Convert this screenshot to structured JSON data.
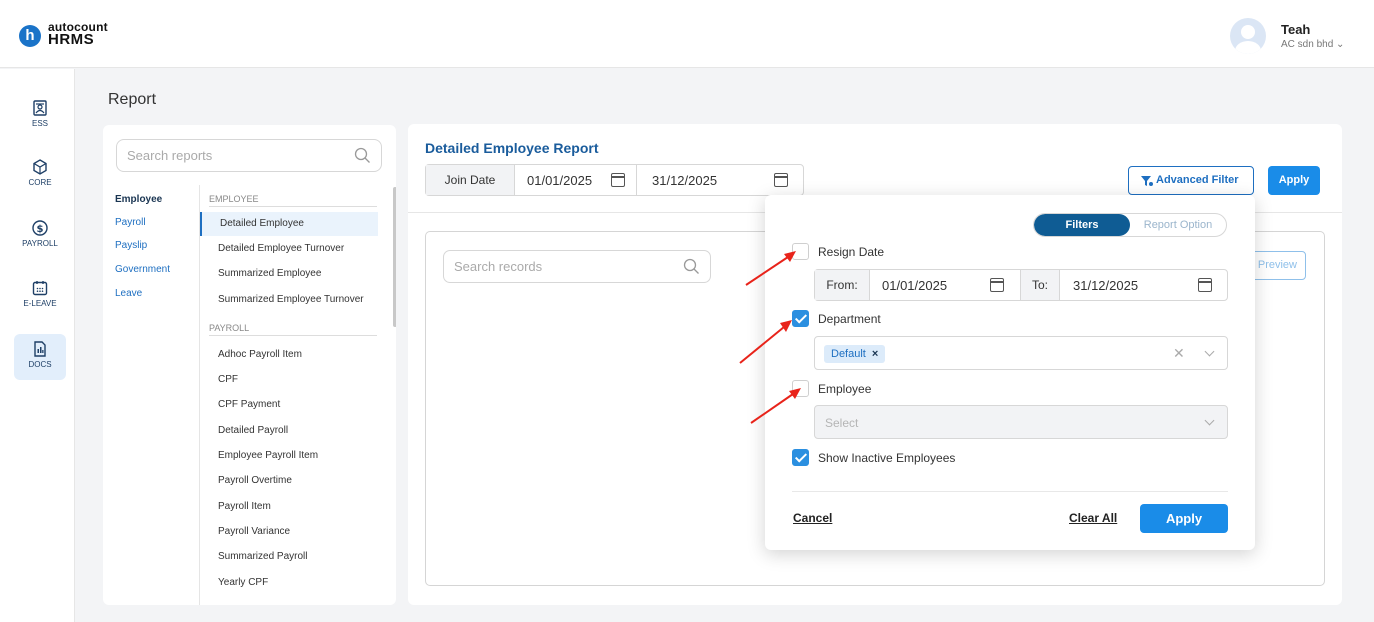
{
  "brand": {
    "top": "autocount",
    "bottom": "HRMS",
    "mark": "h"
  },
  "user": {
    "name": "Teah",
    "company": "AC sdn bhd"
  },
  "nav": [
    {
      "label": "ESS",
      "icon": "ess-icon"
    },
    {
      "label": "CORE",
      "icon": "core-icon"
    },
    {
      "label": "PAYROLL",
      "icon": "payroll-icon"
    },
    {
      "label": "E-LEAVE",
      "icon": "calendar-icon"
    },
    {
      "label": "DOCS",
      "icon": "docs-icon",
      "active": true
    }
  ],
  "page_title": "Report",
  "reports_panel": {
    "search_placeholder": "Search reports",
    "categories": [
      "Employee",
      "Payroll",
      "Payslip",
      "Government",
      "Leave"
    ],
    "sections": [
      {
        "header": "EMPLOYEE",
        "items": [
          "Detailed Employee",
          "Detailed Employee Turnover",
          "Summarized Employee",
          "Summarized Employee Turnover"
        ]
      },
      {
        "header": "PAYROLL",
        "items": [
          "Adhoc Payroll Item",
          "CPF",
          "CPF Payment",
          "Detailed Payroll",
          "Employee Payroll Item",
          "Payroll Overtime",
          "Payroll Item",
          "Payroll Variance",
          "Summarized Payroll",
          "Yearly CPF"
        ]
      }
    ],
    "active_item": "Detailed Employee"
  },
  "main": {
    "report_title": "Detailed Employee Report",
    "date_label": "Join Date",
    "date_from": "01/01/2025",
    "date_to": "31/12/2025",
    "advanced_filter_label": "Advanced Filter",
    "apply_label": "Apply",
    "search_records_placeholder": "Search records",
    "preview_label": "Preview"
  },
  "filter_popup": {
    "tabs": {
      "active": "Filters",
      "inactive": "Report Option"
    },
    "resign_date": {
      "label": "Resign Date",
      "checked": false,
      "from_label": "From:",
      "from": "01/01/2025",
      "to_label": "To:",
      "to": "31/12/2025"
    },
    "department": {
      "label": "Department",
      "checked": true,
      "tag": "Default",
      "tag_remove": "×"
    },
    "employee": {
      "label": "Employee",
      "checked": false,
      "placeholder": "Select"
    },
    "show_inactive": {
      "label": "Show Inactive Employees",
      "checked": true
    },
    "cancel_label": "Cancel",
    "clear_all_label": "Clear All",
    "apply_label": "Apply"
  },
  "colors": {
    "primary": "#1a8ce8",
    "navy": "#0f5c94",
    "link": "#1e6fc1",
    "arrow": "#e8231a"
  }
}
